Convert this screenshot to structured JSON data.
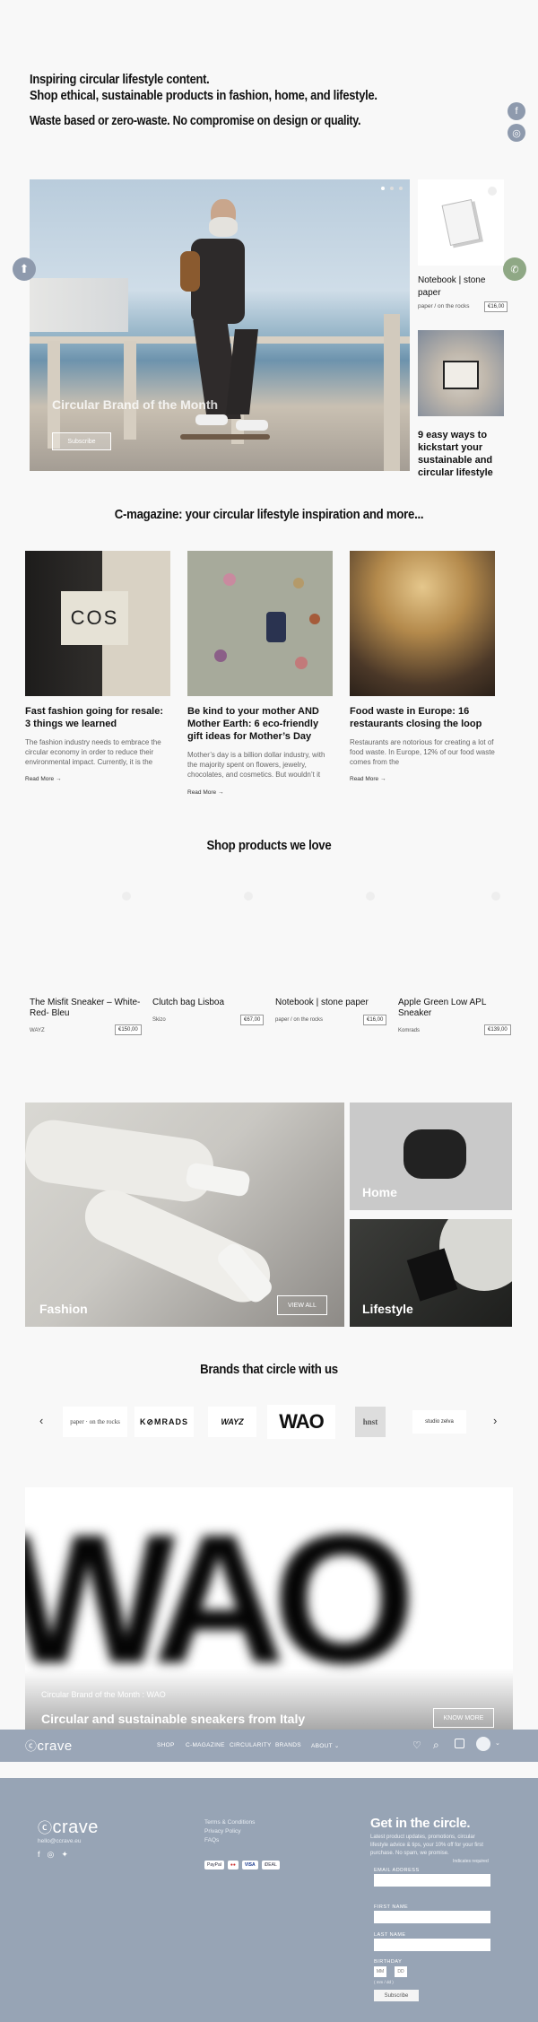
{
  "hero": {
    "line1": "Inspiring circular lifestyle content.",
    "line2": "Shop ethical, sustainable products in fashion, home, and lifestyle.",
    "line3": "Waste based or zero-waste. No compromise on design or quality."
  },
  "social": {
    "facebook": "f",
    "instagram": "◎"
  },
  "slider": {
    "caption": "Circular Brand of the Month",
    "button": "Subscribe"
  },
  "side_cards": [
    {
      "title": "Notebook | stone paper",
      "brand": "paper / on the rocks",
      "price": "€16,00"
    },
    {
      "title": "9 easy ways to kickstart your sustainable and circular lifestyle"
    }
  ],
  "magazine": {
    "title": "C-magazine: your circular lifestyle inspiration and more...",
    "readmore": "Read More →",
    "articles": [
      {
        "image_text": "COS",
        "title": "Fast fashion going for resale: 3 things we learned",
        "text": "The fashion industry needs to embrace the circular economy in order to reduce their environmental impact. Currently, it is the"
      },
      {
        "title": "Be kind to your mother AND Mother Earth: 6 eco-friendly gift ideas for Mother’s Day",
        "text": "Mother’s day is a billion dollar industry, with the majority spent on flowers, jewelry, chocolates, and cosmetics. But wouldn’t it"
      },
      {
        "title": "Food waste in Europe: 16 restaurants closing the loop",
        "text": "Restaurants are notorious for creating a lot of food waste. In Europe, 12% of our food waste comes from the"
      }
    ]
  },
  "products": {
    "title": "Shop products we love",
    "items": [
      {
        "name": "The Misfit Sneaker – White-Red- Bleu",
        "brand": "WAYZ",
        "price": "€150,00"
      },
      {
        "name": "Clutch bag Lisboa",
        "brand": "Skizo",
        "price": "€67,00"
      },
      {
        "name": "Notebook | stone paper",
        "brand": "paper / on the rocks",
        "price": "€16,00"
      },
      {
        "name": "Apple Green Low APL Sneaker",
        "brand": "Komrads",
        "price": "€139,00"
      }
    ]
  },
  "categories": {
    "fashion": "Fashion",
    "home": "Home",
    "lifestyle": "Lifestyle",
    "view_all": "VIEW ALL"
  },
  "brands": {
    "title": "Brands that circle with us",
    "logos": [
      "paper · on the rocks",
      "K⊘MRADS",
      "WAYZ",
      "WAO",
      "hnst",
      "studio zelva"
    ],
    "prev": "‹",
    "next": "›"
  },
  "brand_banner": {
    "big_logo": "WAO",
    "caption": "Circular Brand of the Month : WAO",
    "subcaption": "Circular and sustainable sneakers from Italy",
    "button": "KNOW MORE"
  },
  "navbar": {
    "logo": "crave",
    "items": [
      "SHOP",
      "C-MAGAZINE",
      "CIRCULARITY",
      "BRANDS",
      "ABOUT ⌄"
    ]
  },
  "footer": {
    "logo": "crave",
    "email": "hello@ccrave.eu",
    "links": [
      "Terms & Conditions",
      "Privacy Policy",
      "FAQs"
    ],
    "payments": [
      "PayPal",
      "●●",
      "VISA",
      "iDEAL"
    ],
    "newsletter": {
      "title": "Get in the circle.",
      "text": "Latest product updates, promotions, circular lifestyle advice & tips, your 10% off for your first purchase. No spam, we promise.",
      "required": "Indicates required",
      "email_label": "EMAIL ADDRESS",
      "first_label": "FIRST NAME",
      "last_label": "LAST NAME",
      "birthday_label": "BIRTHDAY",
      "mm": "MM",
      "dd": "DD",
      "date_hint": "( mm / dd )",
      "button": "Subscribe"
    }
  },
  "colors": {
    "footer_bg": "#97a4b5",
    "navbar_bg": "#9aa6b7",
    "social_bg": "#8e9aad"
  }
}
